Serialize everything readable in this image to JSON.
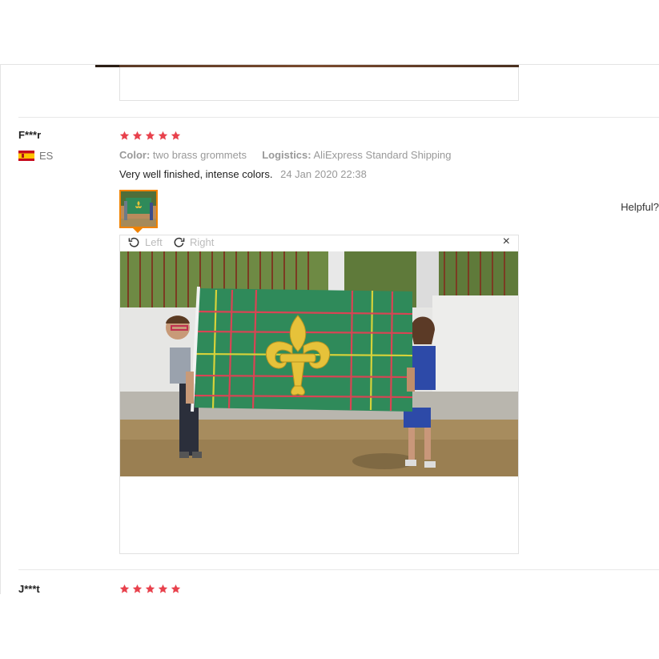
{
  "reviews": [
    {
      "user": "F***r",
      "country": "ES",
      "stars": 5,
      "color_label": "Color:",
      "color_value": "two brass grommets",
      "logistics_label": "Logistics:",
      "logistics_value": "AliExpress Standard Shipping",
      "text": "Very well finished, intense colors.",
      "date": "24 Jan 2020 22:38",
      "helpful_label": "Helpful?"
    },
    {
      "user": "J***t",
      "stars": 5
    }
  ],
  "viewer": {
    "left_label": "Left",
    "right_label": "Right",
    "close_symbol": "×"
  },
  "colors": {
    "star": "#e8414c",
    "thumb_border": "#f08200"
  }
}
